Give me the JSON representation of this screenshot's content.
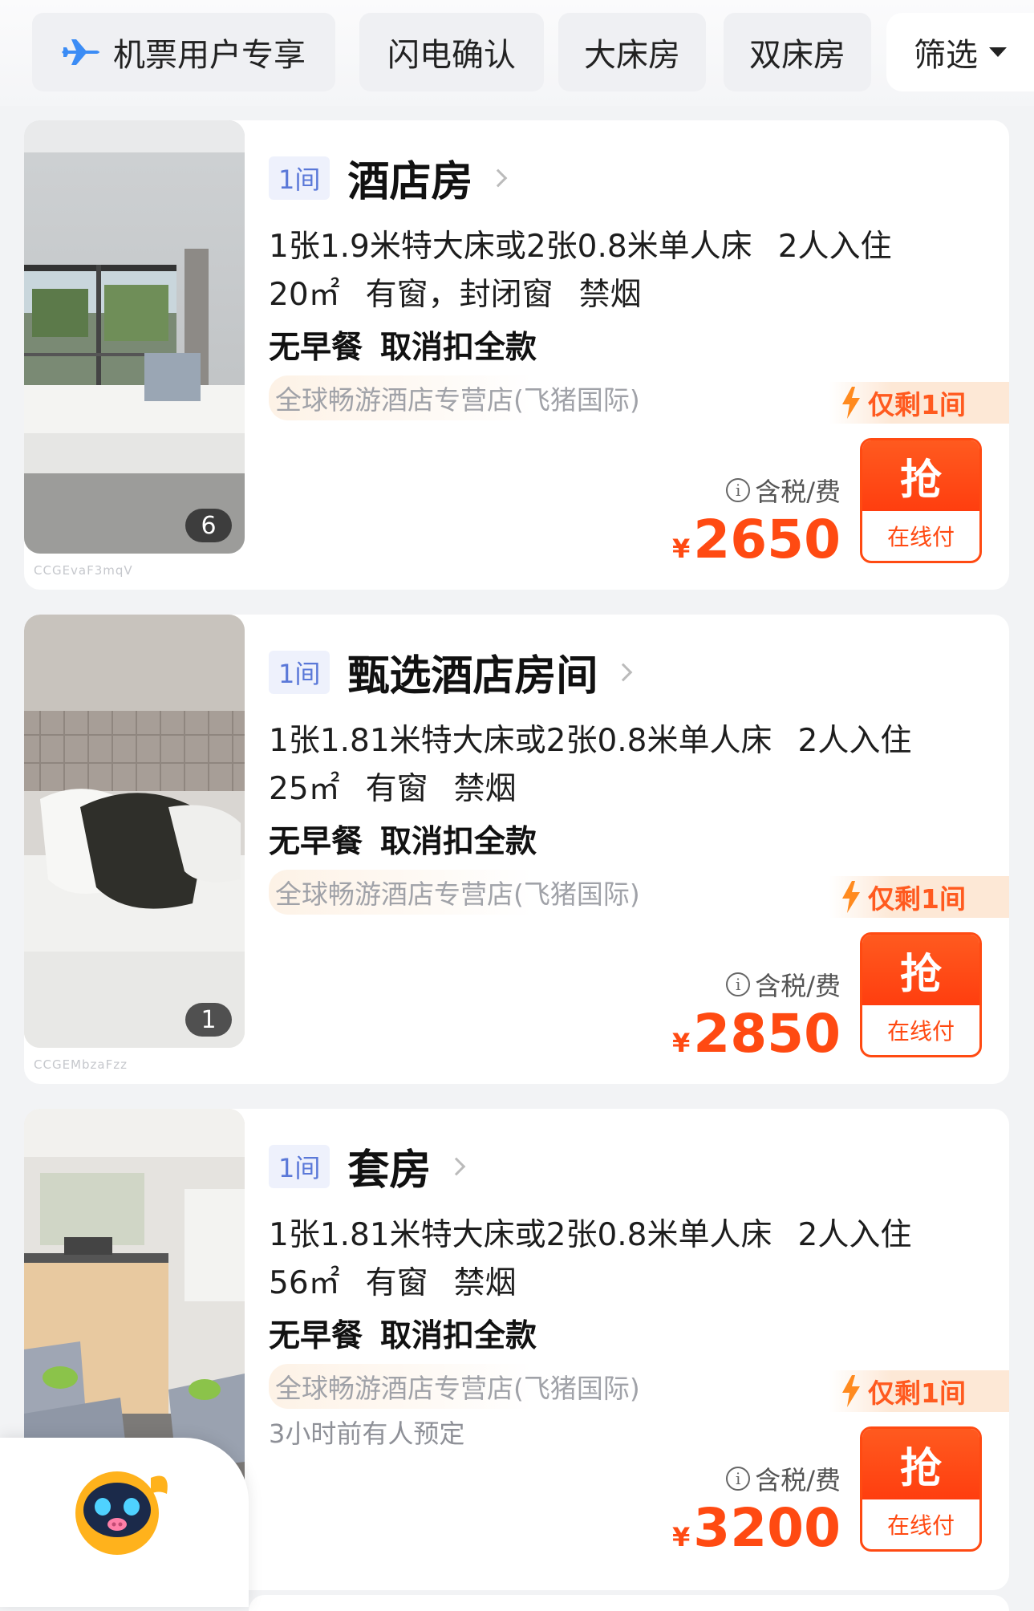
{
  "filters": [
    {
      "label": "机票用户专享",
      "icon": "plane-icon"
    },
    {
      "label": "闪电确认"
    },
    {
      "label": "大床房"
    },
    {
      "label": "双床房"
    },
    {
      "label": "筛选",
      "icon": "caret-down-icon"
    }
  ],
  "accent": "#ff4a12",
  "rooms": [
    {
      "qty": "1间",
      "name": "酒店房",
      "beds": "1张1.9米特大床或2张0.8米单人床",
      "guests": "2人入住",
      "area": "20㎡",
      "window": "有窗，封闭窗",
      "smoke": "禁烟",
      "breakfast": "无早餐",
      "cancel": "取消扣全款",
      "shop": "全球畅游酒店专营店(飞猪国际)",
      "recent": "",
      "stock": "仅剩1间",
      "tax": "含税/费",
      "currency": "¥",
      "price": "2650",
      "buy": "抢",
      "pay": "在线付",
      "image_count": "6",
      "image_code": "CCGEvaF3mqV"
    },
    {
      "qty": "1间",
      "name": "甄选酒店房间",
      "beds": "1张1.81米特大床或2张0.8米单人床",
      "guests": "2人入住",
      "area": "25㎡",
      "window": "有窗",
      "smoke": "禁烟",
      "breakfast": "无早餐",
      "cancel": "取消扣全款",
      "shop": "全球畅游酒店专营店(飞猪国际)",
      "recent": "",
      "stock": "仅剩1间",
      "tax": "含税/费",
      "currency": "¥",
      "price": "2850",
      "buy": "抢",
      "pay": "在线付",
      "image_count": "1",
      "image_code": "CCGEMbzaFzz"
    },
    {
      "qty": "1间",
      "name": "套房",
      "beds": "1张1.81米特大床或2张0.8米单人床",
      "guests": "2人入住",
      "area": "56㎡",
      "window": "有窗",
      "smoke": "禁烟",
      "breakfast": "无早餐",
      "cancel": "取消扣全款",
      "shop": "全球畅游酒店专营店(飞猪国际)",
      "recent": "3小时前有人预定",
      "stock": "仅剩1间",
      "tax": "含税/费",
      "currency": "¥",
      "price": "3200",
      "buy": "抢",
      "pay": "在线付",
      "image_count": "",
      "image_code": ""
    }
  ]
}
